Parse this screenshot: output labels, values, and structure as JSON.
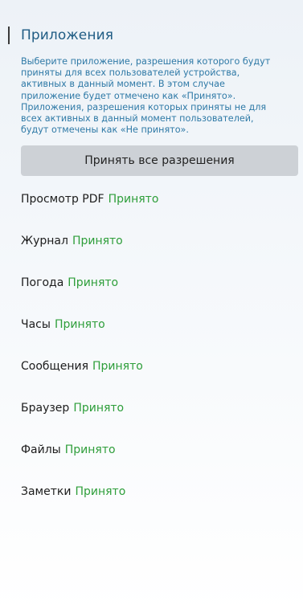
{
  "section": {
    "title": "Приложения",
    "description": "Выберите приложение, разрешения которого будут приняты для всех пользователей устройства, активных в данный момент. В этом случае приложение будет отмечено как «Принято». Приложения, разрешения которых приняты не для всех активных в данный момент пользователей, будут отмечены как «Не принято»."
  },
  "accept_all_button": {
    "label": "Принять все разрешения"
  },
  "apps": [
    {
      "name": "Просмотр PDF",
      "status": "Принято"
    },
    {
      "name": "Журнал",
      "status": "Принято"
    },
    {
      "name": "Погода",
      "status": "Принято"
    },
    {
      "name": "Часы",
      "status": "Принято"
    },
    {
      "name": "Сообщения",
      "status": "Принято"
    },
    {
      "name": "Браузер",
      "status": "Принято"
    },
    {
      "name": "Файлы",
      "status": "Принято"
    },
    {
      "name": "Заметки",
      "status": "Принято"
    }
  ],
  "colors": {
    "title": "#1f5c84",
    "description": "#2e79a6",
    "status_accepted": "#2e9e3a",
    "button_bg": "#cdd1d6"
  }
}
